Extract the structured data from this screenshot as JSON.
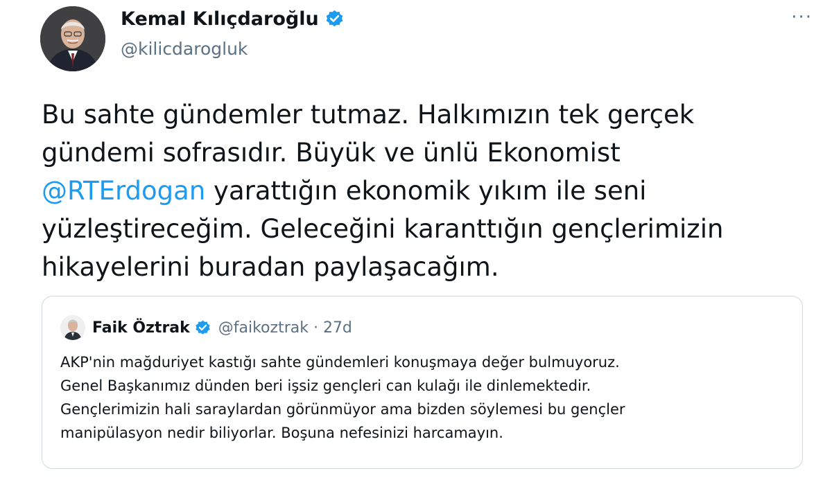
{
  "author": {
    "display_name": "Kemal Kılıçdaroğlu",
    "handle": "@kilicdarogluk",
    "avatar_icon": "profile-photo",
    "verified_icon": "verified-badge-icon"
  },
  "menu": {
    "more_icon": "more-options-icon",
    "more_glyph": "···"
  },
  "tweet": {
    "lines": [
      {
        "text": "Bu sahte gündemler tutmaz. Halkımızın tek gerçek"
      },
      {
        "text": "gündemi sofrasıdır. Büyük ve ünlü Ekonomist"
      },
      {
        "mention": "@RTErdogan",
        "text": " yarattığın ekonomik yıkım ile seni"
      },
      {
        "text": "yüzleştireceğim. Geleceğini karanttığın gençlerimizin"
      },
      {
        "text": "hikayelerini buradan paylaşacağım."
      }
    ]
  },
  "quoted_tweet": {
    "display_name": "Faik Öztrak",
    "meta": "@faikoztrak · 27d",
    "lines": [
      "AKP'nin mağduriyet kastığı sahte gündemleri konuşmaya değer bulmuyoruz.",
      "Genel Başkanımız dünden beri işsiz gençleri can kulağı ile dinlemektedir.",
      "Gençlerimizin hali saraylardan görünmüyor ama bizden söylemesi bu gençler",
      "manipülasyon nedir biliyorlar. Boşuna nefesinizi harcamayın."
    ]
  },
  "colors": {
    "verified": "#1d9bf0",
    "mention": "#1d9bf0",
    "secondary_text": "#5b7083",
    "border": "#cfd9de"
  }
}
